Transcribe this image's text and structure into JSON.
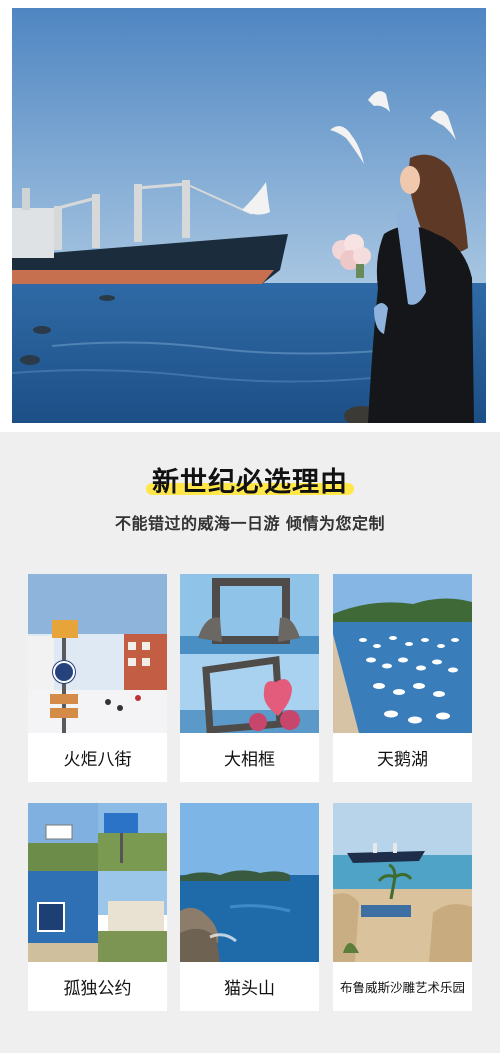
{
  "header": {
    "title": "新世纪必选理由",
    "subtitle": "不能错过的威海一日游   倾情为您定制"
  },
  "cards": [
    {
      "label": "火炬八街"
    },
    {
      "label": "大相框"
    },
    {
      "label": "天鹅湖"
    },
    {
      "label": "孤独公约"
    },
    {
      "label": "猫头山"
    },
    {
      "label": "布鲁威斯沙雕艺术乐园"
    }
  ],
  "colors": {
    "highlight": "#ffe74a",
    "section_bg": "#efefef",
    "sky": "#5b90c8",
    "sea": "#2a5d97"
  }
}
